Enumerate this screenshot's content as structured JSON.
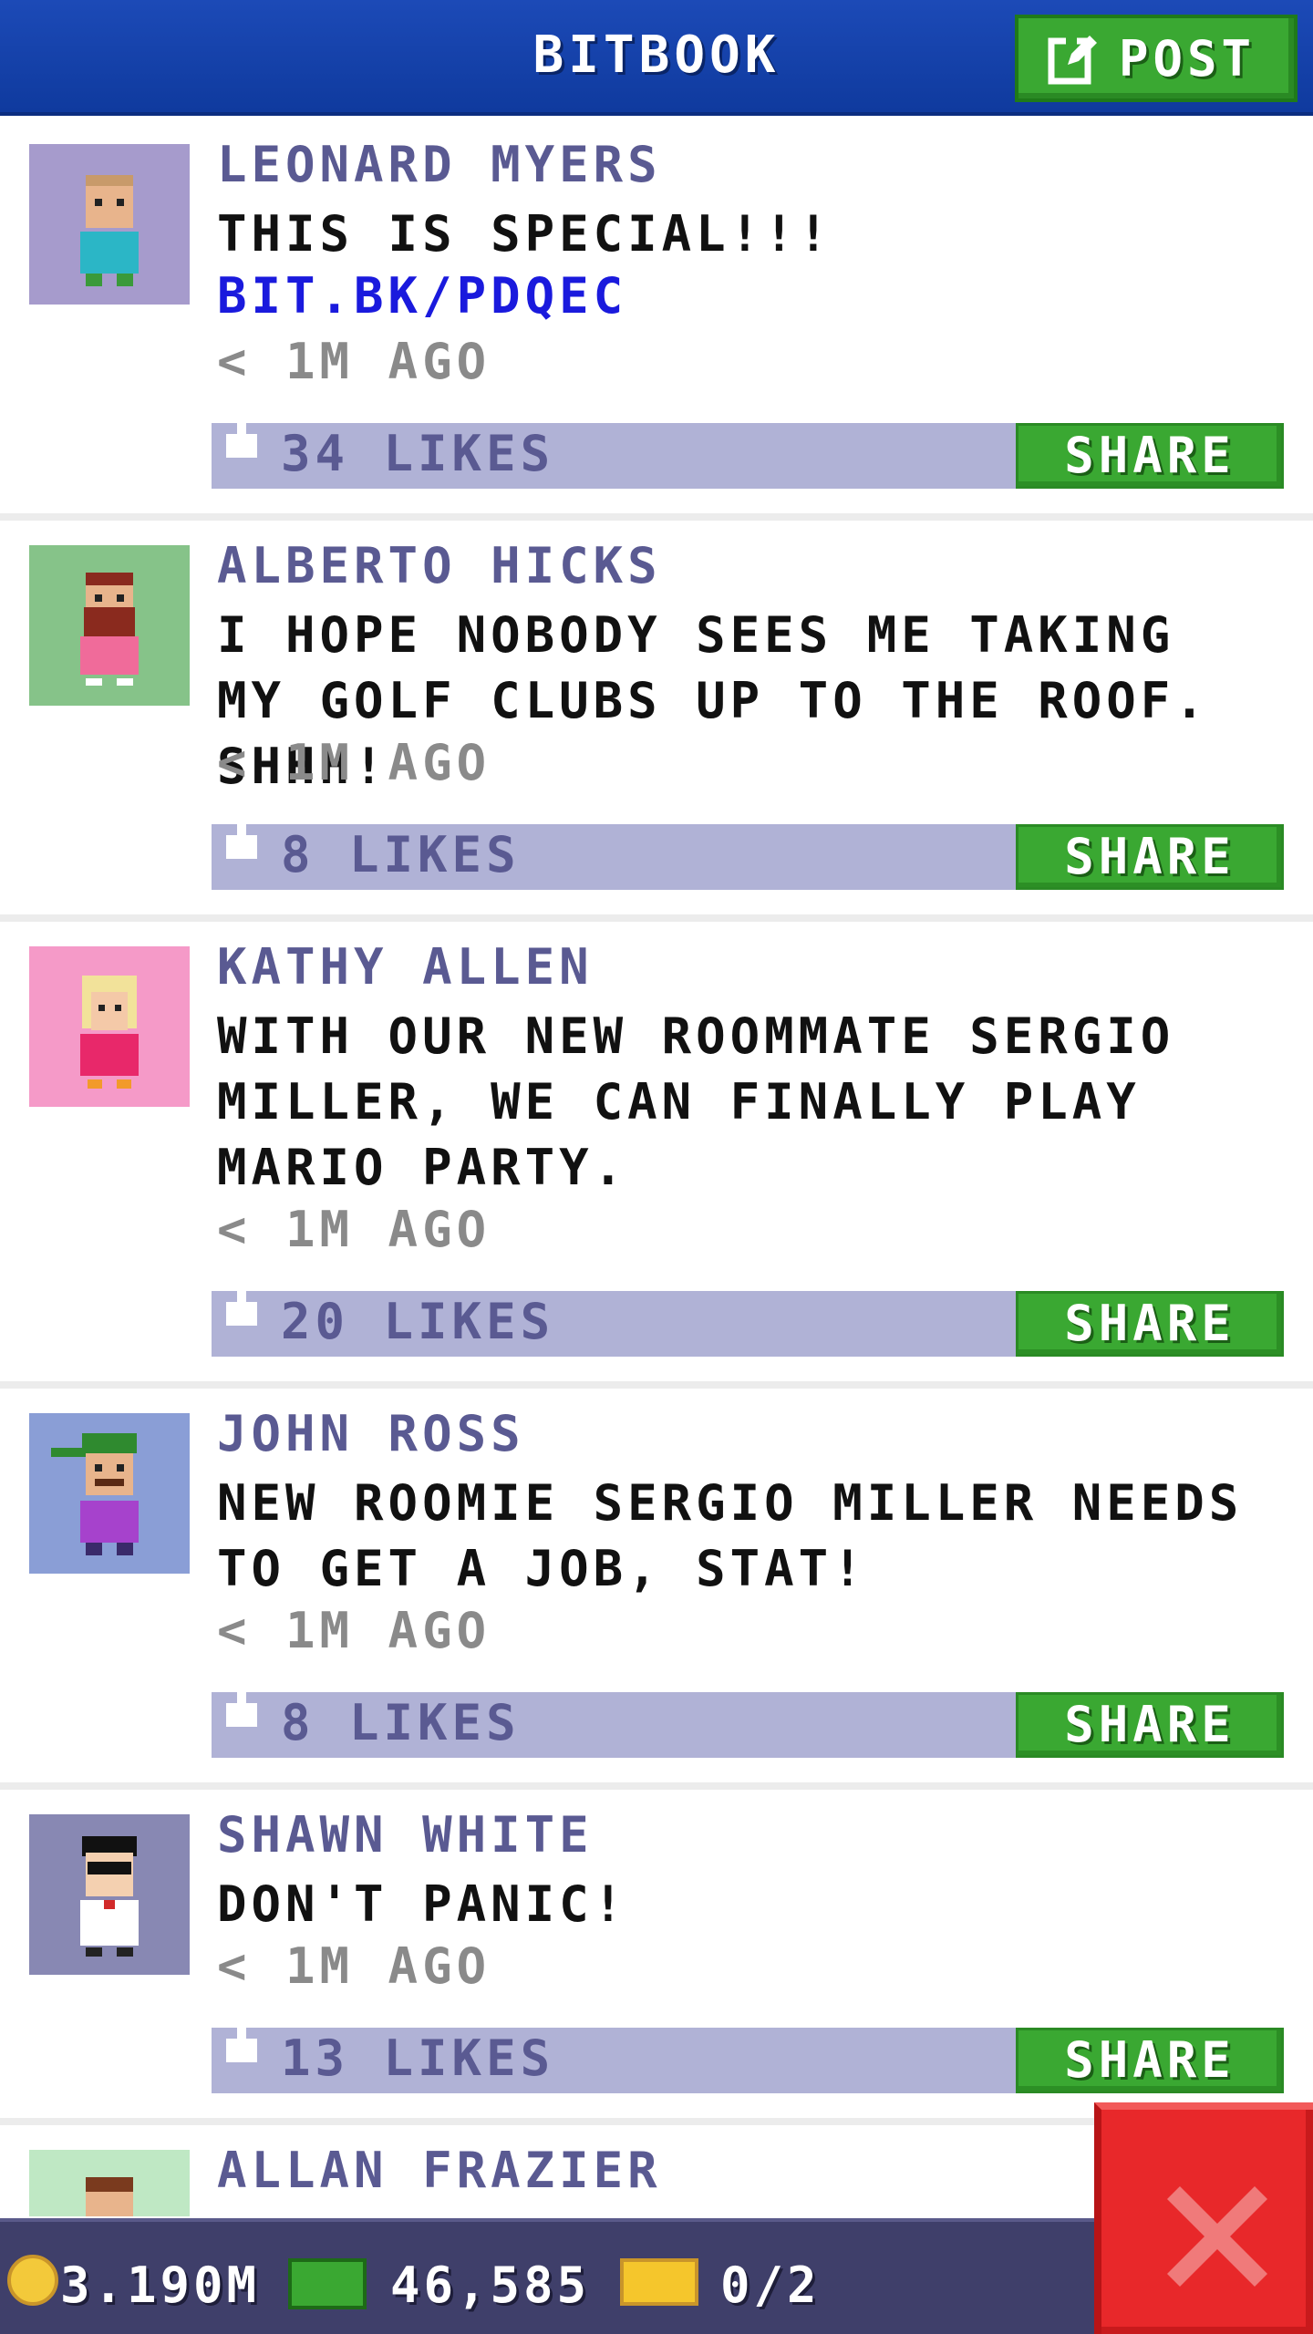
{
  "header": {
    "title": "BITBOOK",
    "post_label": "POST"
  },
  "feed": {
    "posts": [
      {
        "author": "LEONARD MYERS",
        "text": "THIS IS SPECIAL!!!",
        "link": "BIT.BK/PDQEC",
        "time": "< 1M AGO",
        "likes": "34 LIKES",
        "share_label": "SHARE",
        "avatar_bg": "#a69bcc"
      },
      {
        "author": "ALBERTO HICKS",
        "text": "I HOPE NOBODY SEES ME TAKING MY GOLF CLUBS UP TO THE ROOF. SHHH!",
        "time": "< 1M AGO",
        "likes": "8 LIKES",
        "share_label": "SHARE",
        "avatar_bg": "#86c389"
      },
      {
        "author": "KATHY ALLEN",
        "text": "WITH OUR NEW ROOMMATE SERGIO MILLER, WE CAN FINALLY PLAY MARIO PARTY.",
        "time": "< 1M AGO",
        "likes": "20 LIKES",
        "share_label": "SHARE",
        "avatar_bg": "#f59ac8"
      },
      {
        "author": "JOHN ROSS",
        "text": "NEW ROOMIE SERGIO MILLER NEEDS TO GET A JOB, STAT!",
        "time": "< 1M AGO",
        "likes": "8 LIKES",
        "share_label": "SHARE",
        "avatar_bg": "#8a9ed6"
      },
      {
        "author": "SHAWN WHITE",
        "text": "DON'T PANIC!",
        "time": "< 1M AGO",
        "likes": "13 LIKES",
        "share_label": "SHARE",
        "avatar_bg": "#8888b3"
      },
      {
        "author": "ALLAN FRAZIER",
        "avatar_bg": "#bfe8c4"
      }
    ]
  },
  "status_bar": {
    "coins": "3.190M",
    "bux": "46,585",
    "tickets": "0/2"
  },
  "icons": {
    "compose": "compose-icon",
    "like": "thumbs-up-icon",
    "close": "close-icon",
    "coin": "coin-icon",
    "bux": "bux-icon",
    "ticket": "ticket-icon"
  },
  "colors": {
    "header_bg": "#1c4ab7",
    "accent_green": "#3aa832",
    "like_bar": "#b0b2d6",
    "name_text": "#5a5a92",
    "link_text": "#1a1add",
    "close_red": "#e8282a",
    "status_bar": "#3f3f6a"
  }
}
